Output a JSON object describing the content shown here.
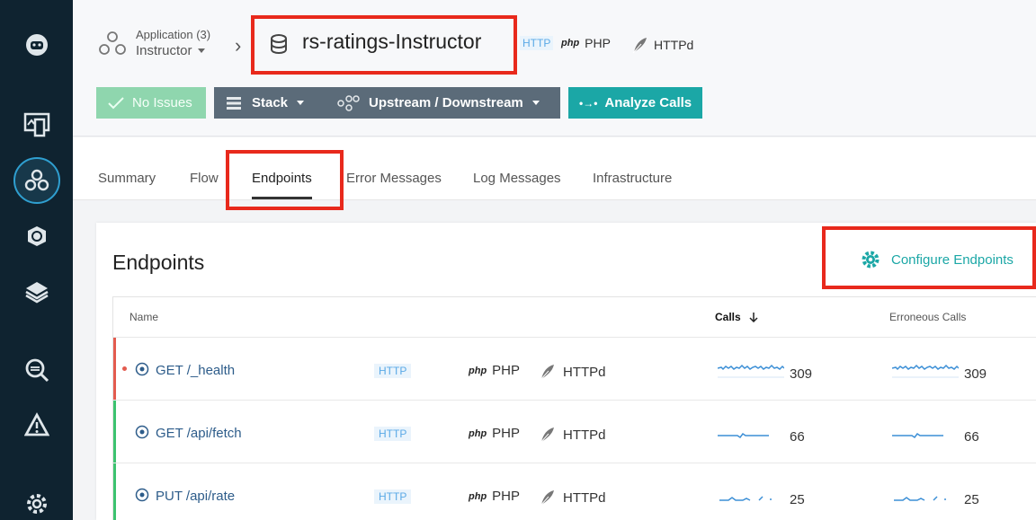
{
  "breadcrumb": {
    "app_label": "Application (3)",
    "app_name": "Instructor",
    "service_title": "rs-ratings-Instructor"
  },
  "header_tech": {
    "http": "HTTP",
    "php": "PHP",
    "php_logo": "php",
    "httpd": "HTTPd"
  },
  "actions": {
    "no_issues": "No Issues",
    "stack": "Stack",
    "upstream": "Upstream / Downstream",
    "analyze": "Analyze Calls"
  },
  "tabs": [
    "Summary",
    "Flow",
    "Endpoints",
    "Error Messages",
    "Log Messages",
    "Infrastructure"
  ],
  "card": {
    "title": "Endpoints",
    "configure": "Configure Endpoints"
  },
  "table": {
    "headers": {
      "name": "Name",
      "calls": "Calls",
      "erroneous": "Erroneous Calls"
    },
    "rows": [
      {
        "name": "GET /_health",
        "http": "HTTP",
        "php": "PHP",
        "php_logo": "php",
        "httpd": "HTTPd",
        "calls": "309",
        "erroneous": "309",
        "status": "error"
      },
      {
        "name": "GET /api/fetch",
        "http": "HTTP",
        "php": "PHP",
        "php_logo": "php",
        "httpd": "HTTPd",
        "calls": "66",
        "erroneous": "66",
        "status": "ok"
      },
      {
        "name": "PUT /api/rate",
        "http": "HTTP",
        "php": "PHP",
        "php_logo": "php",
        "httpd": "HTTPd",
        "calls": "25",
        "erroneous": "25",
        "status": "ok"
      }
    ]
  },
  "colors": {
    "error": "#e35b4f",
    "ok": "#3cc26f",
    "accent": "#1ba7a6",
    "highlight": "#e8291c"
  },
  "sidebar_icons": [
    "robot-icon",
    "devices-icon",
    "services-icon",
    "kubernetes-icon",
    "layers-icon",
    "analytics-search-icon",
    "alert-icon",
    "settings-icon"
  ]
}
